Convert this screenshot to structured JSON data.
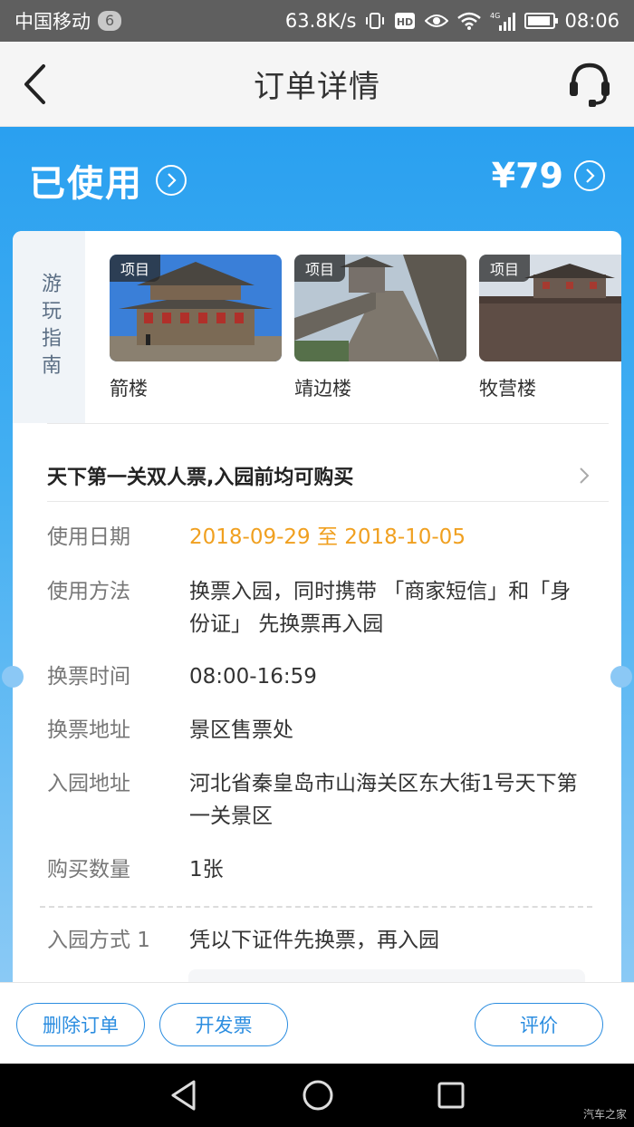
{
  "status_bar": {
    "carrier": "中国移动",
    "carrier_badge": "6",
    "net_speed": "63.8K/s",
    "network_type": "4G",
    "time": "08:06",
    "hd_label": "HD"
  },
  "header": {
    "title": "订单详情",
    "back_icon": "chevron-left-icon",
    "service_icon": "headset-icon"
  },
  "order": {
    "status": "已使用",
    "price": "¥79"
  },
  "guide": {
    "tab_label": "游玩指南",
    "spots": [
      {
        "tag": "项目",
        "name": "箭楼"
      },
      {
        "tag": "项目",
        "name": "靖边楼"
      },
      {
        "tag": "项目",
        "name": "牧营楼"
      }
    ]
  },
  "ticket": {
    "name": "天下第一关双人票,入园前均可购买"
  },
  "details": {
    "use_date": {
      "label": "使用日期",
      "value": "2018-09-29 至 2018-10-05"
    },
    "use_method": {
      "label": "使用方法",
      "value": "换票入园，同时携带 「商家短信」和「身份证」 先换票再入园"
    },
    "exchange_time": {
      "label": "换票时间",
      "value": "08:00-16:59"
    },
    "exchange_address": {
      "label": "换票地址",
      "value": "景区售票处"
    },
    "park_address": {
      "label": "入园地址",
      "value": "河北省秦皇岛市山海关区东大街1号天下第一关景区"
    },
    "quantity": {
      "label": "购买数量",
      "value": "1张"
    },
    "entry_method": {
      "label": "入园方式 1",
      "value": "凭以下证件先换票，再入园"
    }
  },
  "actions": {
    "delete_order": "删除订单",
    "invoice": "开发票",
    "review": "评价"
  },
  "watermark": "汽车之家",
  "colors": {
    "accent_blue": "#2b8de0",
    "header_blue": "#2aa0f0",
    "date_orange": "#f0a020"
  }
}
